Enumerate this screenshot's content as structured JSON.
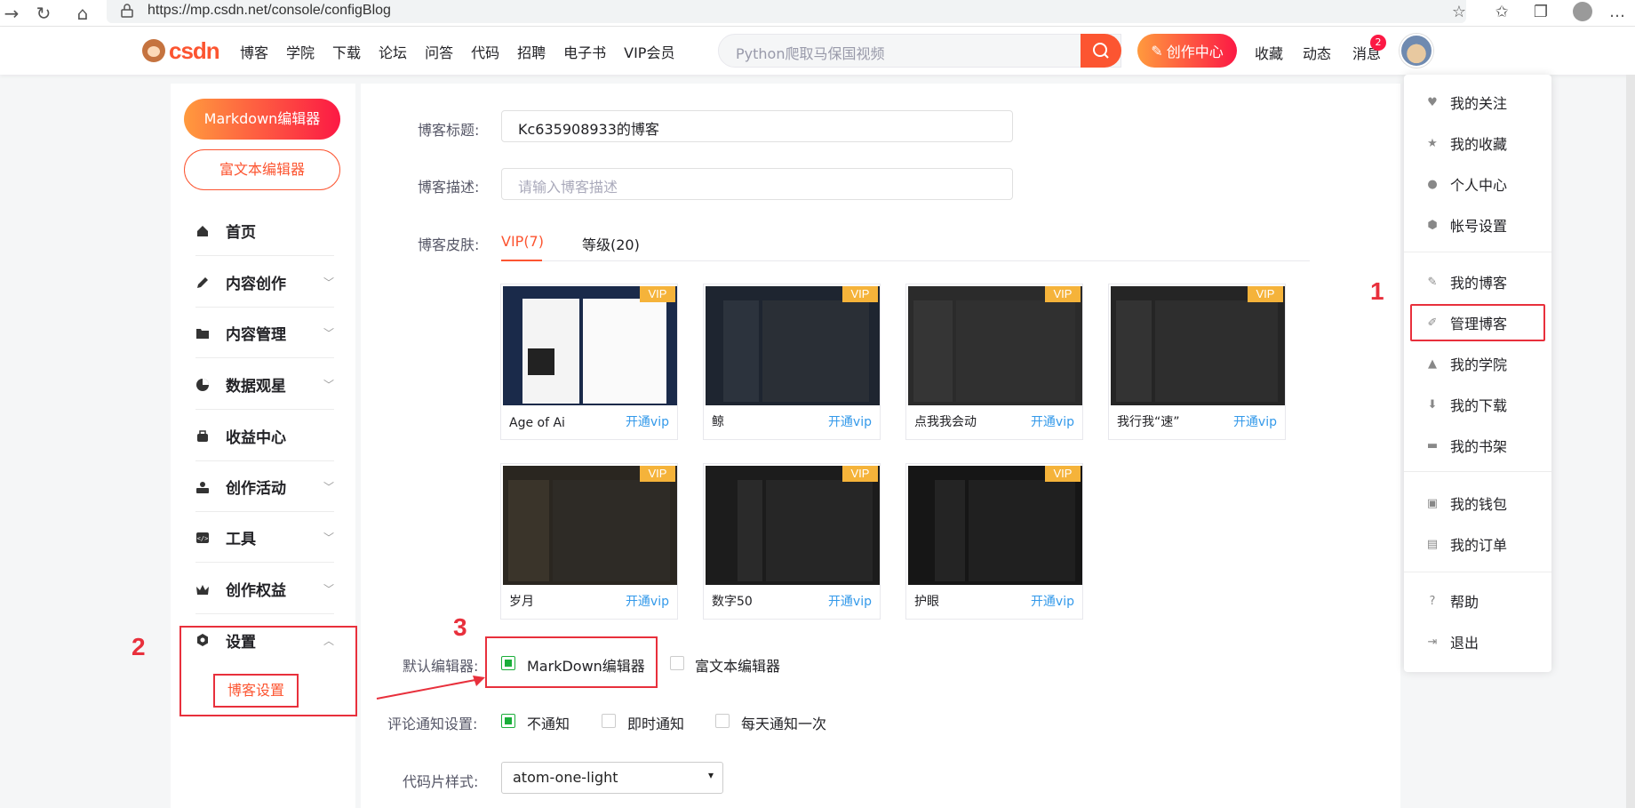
{
  "browser": {
    "url": "https://mp.csdn.net/console/configBlog"
  },
  "header": {
    "logo": "csdn",
    "nav": [
      "博客",
      "学院",
      "下载",
      "论坛",
      "问答",
      "代码",
      "招聘",
      "电子书",
      "VIP会员"
    ],
    "search_placeholder": "Python爬取马保国视频",
    "create_label": "创作中心",
    "links": [
      "收藏",
      "动态",
      "消息"
    ],
    "message_badge": "2"
  },
  "sidebar": {
    "markdown_btn": "Markdown编辑器",
    "richtext_btn": "富文本编辑器",
    "items": [
      {
        "label": "首页",
        "icon": "home-icon",
        "expandable": false
      },
      {
        "label": "内容创作",
        "icon": "pen-icon",
        "expandable": true
      },
      {
        "label": "内容管理",
        "icon": "folder-icon",
        "expandable": true
      },
      {
        "label": "数据观星",
        "icon": "pie-chart-icon",
        "expandable": true
      },
      {
        "label": "收益中心",
        "icon": "wallet-icon",
        "expandable": false
      },
      {
        "label": "创作活动",
        "icon": "activity-icon",
        "expandable": true
      },
      {
        "label": "工具",
        "icon": "code-icon",
        "expandable": true
      },
      {
        "label": "创作权益",
        "icon": "crown-icon",
        "expandable": true
      },
      {
        "label": "设置",
        "icon": "settings-icon",
        "expandable": true
      }
    ],
    "sub_active": "博客设置"
  },
  "form": {
    "title_label": "博客标题:",
    "title_value": "Kc635908933的博客",
    "desc_label": "博客描述:",
    "desc_placeholder": "请输入博客描述",
    "skin_label": "博客皮肤:",
    "tabs": [
      "VIP(7)",
      "等级(20)"
    ],
    "skins": [
      {
        "name": "Age of Ai",
        "action": "开通vip",
        "tag": "VIP"
      },
      {
        "name": "鲸",
        "action": "开通vip",
        "tag": "VIP"
      },
      {
        "name": "点我我会动",
        "action": "开通vip",
        "tag": "VIP"
      },
      {
        "name": "我行我“速”",
        "action": "开通vip",
        "tag": "VIP"
      },
      {
        "name": "岁月",
        "action": "开通vip",
        "tag": "VIP"
      },
      {
        "name": "数字50",
        "action": "开通vip",
        "tag": "VIP"
      },
      {
        "name": "护眼",
        "action": "开通vip",
        "tag": "VIP"
      }
    ],
    "editor_label": "默认编辑器:",
    "editor_options": [
      "MarkDown编辑器",
      "富文本编辑器"
    ],
    "notify_label": "评论通知设置:",
    "notify_options": [
      "不通知",
      "即时通知",
      "每天通知一次"
    ],
    "code_label": "代码片样式:",
    "code_value": "atom-one-light"
  },
  "dropdown": {
    "items": [
      "我的关注",
      "我的收藏",
      "个人中心",
      "帐号设置",
      "我的博客",
      "管理博客",
      "我的学院",
      "我的下载",
      "我的书架",
      "我的钱包",
      "我的订单",
      "帮助",
      "退出"
    ]
  },
  "annotations": [
    "1",
    "2",
    "3"
  ],
  "colors": {
    "accent": "#fc5531",
    "annotation": "#e8303c",
    "check": "#1aae3a",
    "link": "#3399ea"
  }
}
